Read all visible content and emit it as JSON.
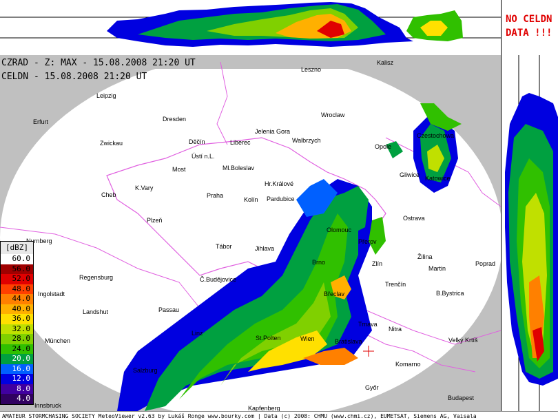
{
  "title_lines": {
    "czrad": "CZRAD - Z: MAX - 15.08.2008 21:20 UT",
    "celdn": "CELDN - 15.08.2008 21:20 UT"
  },
  "no_data_notice": {
    "line1": "NO CELDN",
    "line2": "DATA !!!"
  },
  "legend": {
    "unit": "[dBZ]",
    "levels": [
      {
        "label": "60.0",
        "color": "#ffffff"
      },
      {
        "label": "56.0",
        "color": "#a00000"
      },
      {
        "label": "52.0",
        "color": "#e00000"
      },
      {
        "label": "48.0",
        "color": "#ff4000"
      },
      {
        "label": "44.0",
        "color": "#ff8000"
      },
      {
        "label": "40.0",
        "color": "#ffb000"
      },
      {
        "label": "36.0",
        "color": "#ffe000"
      },
      {
        "label": "32.0",
        "color": "#c0e000"
      },
      {
        "label": "28.0",
        "color": "#80d000"
      },
      {
        "label": "24.0",
        "color": "#30c000"
      },
      {
        "label": "20.0",
        "color": "#00a040"
      },
      {
        "label": "16.0",
        "color": "#0060ff"
      },
      {
        "label": "12.0",
        "color": "#0000e0"
      },
      {
        "label": "8.0",
        "color": "#4000a0"
      },
      {
        "label": "4.0",
        "color": "#300060"
      }
    ]
  },
  "cities": [
    "Leszno",
    "Kalisz",
    "Leipzig",
    "Erfurt",
    "Dresden",
    "Wroclaw",
    "Jelenia Gora",
    "Walbrzych",
    "Zwickau",
    "Děčín",
    "Liberec",
    "Ústí n.L.",
    "Most",
    "Ml.Boleslav",
    "Hr.Králové",
    "Opole",
    "Czestochowa",
    "Gliwice",
    "Katowice",
    "Cheb",
    "K.Vary",
    "Praha",
    "Kolín",
    "Pardubice",
    "Plzeň",
    "Olomouc",
    "Ostrava",
    "Přerov",
    "Nurnberg",
    "Tábor",
    "Jihlava",
    "Brno",
    "Zlín",
    "Žilina",
    "Martin",
    "Poprad",
    "Regensburg",
    "Č.Budějovice",
    "Trenčín",
    "Ingolstadt",
    "Břeclav",
    "B.Bystrica",
    "Landshut",
    "Passau",
    "Trnava",
    "Nitra",
    "Linz",
    "St.Polten",
    "Wien",
    "Bratislava",
    "Velký Krtíš",
    "München",
    "Komarno",
    "Salzburg",
    "Győr",
    "Budapest",
    "Innsbruck",
    "Kapfenberg"
  ],
  "footer": "AMATEUR STORMCHASING SOCIETY MeteoViewer v2.63 by Lukáš Ronge www.bourky.com | Data (c) 2008: CHMU (www.chmi.cz), EUMETSAT, Siemens AG, Vaisala"
}
